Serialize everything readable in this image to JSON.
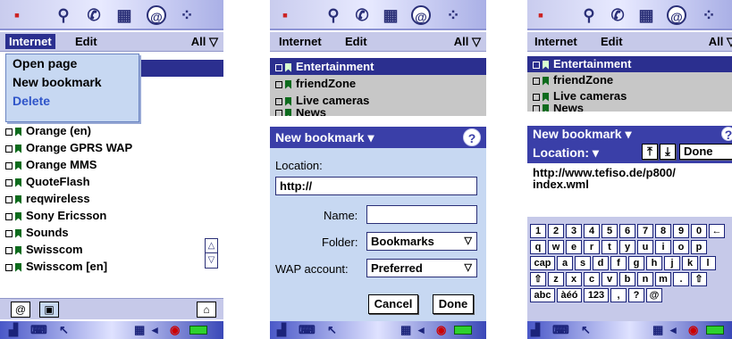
{
  "colors": {
    "accent": "#2b2f8f",
    "panel": "#c7d8f2",
    "menubar": "#c6c9e9"
  },
  "topbar_icons": [
    "book-icon",
    "phone-handset-icon",
    "calendar-icon",
    "web-icon",
    "apps-grid-icon"
  ],
  "topbar_glyphs": [
    "⚙",
    "🕮",
    "✆",
    "☷",
    "@",
    "∷"
  ],
  "menubar": {
    "internet": "Internet",
    "edit": "Edit",
    "all": "All ▽"
  },
  "screen1": {
    "popup": [
      "Open page",
      "New bookmark",
      "Delete"
    ],
    "partial_item": "...News",
    "items": [
      "Orange (en)",
      "Orange GPRS WAP",
      "Orange MMS",
      "QuoteFlash",
      "reqwireless",
      "Sony Ericsson",
      "Sounds",
      "Swisscom",
      "Swisscom [en]"
    ]
  },
  "screen2": {
    "items": [
      "Entertainment",
      "friendZone",
      "Live cameras",
      "News"
    ],
    "dialog_title": "New bookmark ▾",
    "help": "?",
    "location_label": "Location:",
    "location_value": "http://",
    "name_label": "Name:",
    "folder_label": "Folder:",
    "folder_value": "Bookmarks",
    "wap_label": "WAP account:",
    "wap_value": "Preferred",
    "cancel": "Cancel",
    "done": "Done"
  },
  "screen3": {
    "items": [
      "Entertainment",
      "friendZone",
      "Live cameras",
      "News"
    ],
    "dialog_title": "New bookmark ▾",
    "location_label": "Location: ▾",
    "done": "Done",
    "url": "http://www.tefiso.de/p800/ index.wml",
    "keys": {
      "r1": [
        "1",
        "2",
        "3",
        "4",
        "5",
        "6",
        "7",
        "8",
        "9",
        "0",
        "←"
      ],
      "r2": [
        "q",
        "w",
        "e",
        "r",
        "t",
        "y",
        "u",
        "i",
        "o",
        "p"
      ],
      "r3": [
        "cap",
        "a",
        "s",
        "d",
        "f",
        "g",
        "h",
        "j",
        "k",
        "l"
      ],
      "r4": [
        "⇧",
        "z",
        "x",
        "c",
        "v",
        "b",
        "n",
        "m",
        ".",
        "⇧"
      ],
      "r5": [
        "abc",
        "àéó",
        "123",
        ",",
        "?",
        "@"
      ]
    }
  }
}
